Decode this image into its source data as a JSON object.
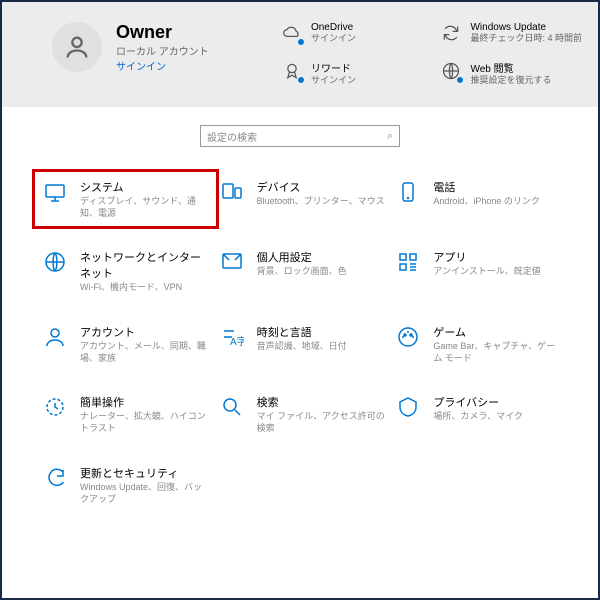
{
  "user": {
    "name": "Owner",
    "account_type": "ローカル アカウント",
    "signin": "サインイン"
  },
  "status": {
    "onedrive": {
      "title": "OneDrive",
      "desc": "サインイン"
    },
    "winupdate": {
      "title": "Windows Update",
      "desc": "最終チェック日時: 4 時間前"
    },
    "rewards": {
      "title": "リワード",
      "desc": "サインイン"
    },
    "web": {
      "title": "Web 閲覧",
      "desc": "推奨設定を復元する"
    }
  },
  "search": {
    "placeholder": "設定の検索"
  },
  "categories": [
    {
      "title": "システム",
      "desc": "ディスプレイ、サウンド、通知、電源"
    },
    {
      "title": "デバイス",
      "desc": "Bluetooth、プリンター、マウス"
    },
    {
      "title": "電話",
      "desc": "Android、iPhone のリンク"
    },
    {
      "title": "ネットワークとインターネット",
      "desc": "Wi-Fi、機内モード、VPN"
    },
    {
      "title": "個人用設定",
      "desc": "背景、ロック画面、色"
    },
    {
      "title": "アプリ",
      "desc": "アンインストール、既定値"
    },
    {
      "title": "アカウント",
      "desc": "アカウント、メール、同期、職場、家族"
    },
    {
      "title": "時刻と言語",
      "desc": "音声認識、地域、日付"
    },
    {
      "title": "ゲーム",
      "desc": "Game Bar、キャプチャ、ゲーム モード"
    },
    {
      "title": "簡単操作",
      "desc": "ナレーター、拡大鏡、ハイコントラスト"
    },
    {
      "title": "検索",
      "desc": "マイ ファイル、アクセス許可の検索"
    },
    {
      "title": "プライバシー",
      "desc": "場所、カメラ、マイク"
    },
    {
      "title": "更新とセキュリティ",
      "desc": "Windows Update、回復、バックアップ"
    }
  ]
}
